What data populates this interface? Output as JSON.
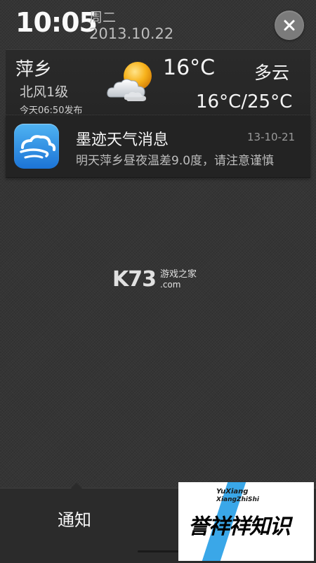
{
  "status": {
    "time": "10:05",
    "weekday": "周二",
    "date": "2013.10.22",
    "close_icon": "close-icon"
  },
  "weather": {
    "city": "萍乡",
    "wind": "北风1级",
    "published": "今天06:50发布",
    "current_temp": "16°C",
    "condition": "多云",
    "temp_range": "16°C/25°C",
    "icon": "partly-cloudy-icon"
  },
  "notification": {
    "app_icon": "moji-weather-app-icon",
    "title": "墨迹天气消息",
    "time": "13-10-21",
    "body": "明天萍乡昼夜温差9.0度，请注意谨慎"
  },
  "watermark": {
    "logo": "K73",
    "line1": "游戏之家",
    "line2": ".com"
  },
  "bottom_bar": {
    "tab_label": "通知"
  },
  "badge": {
    "en_line1": "YuXiang",
    "en_line2": "XiangZhiShi",
    "cn_text": "誉祥祥知识"
  }
}
